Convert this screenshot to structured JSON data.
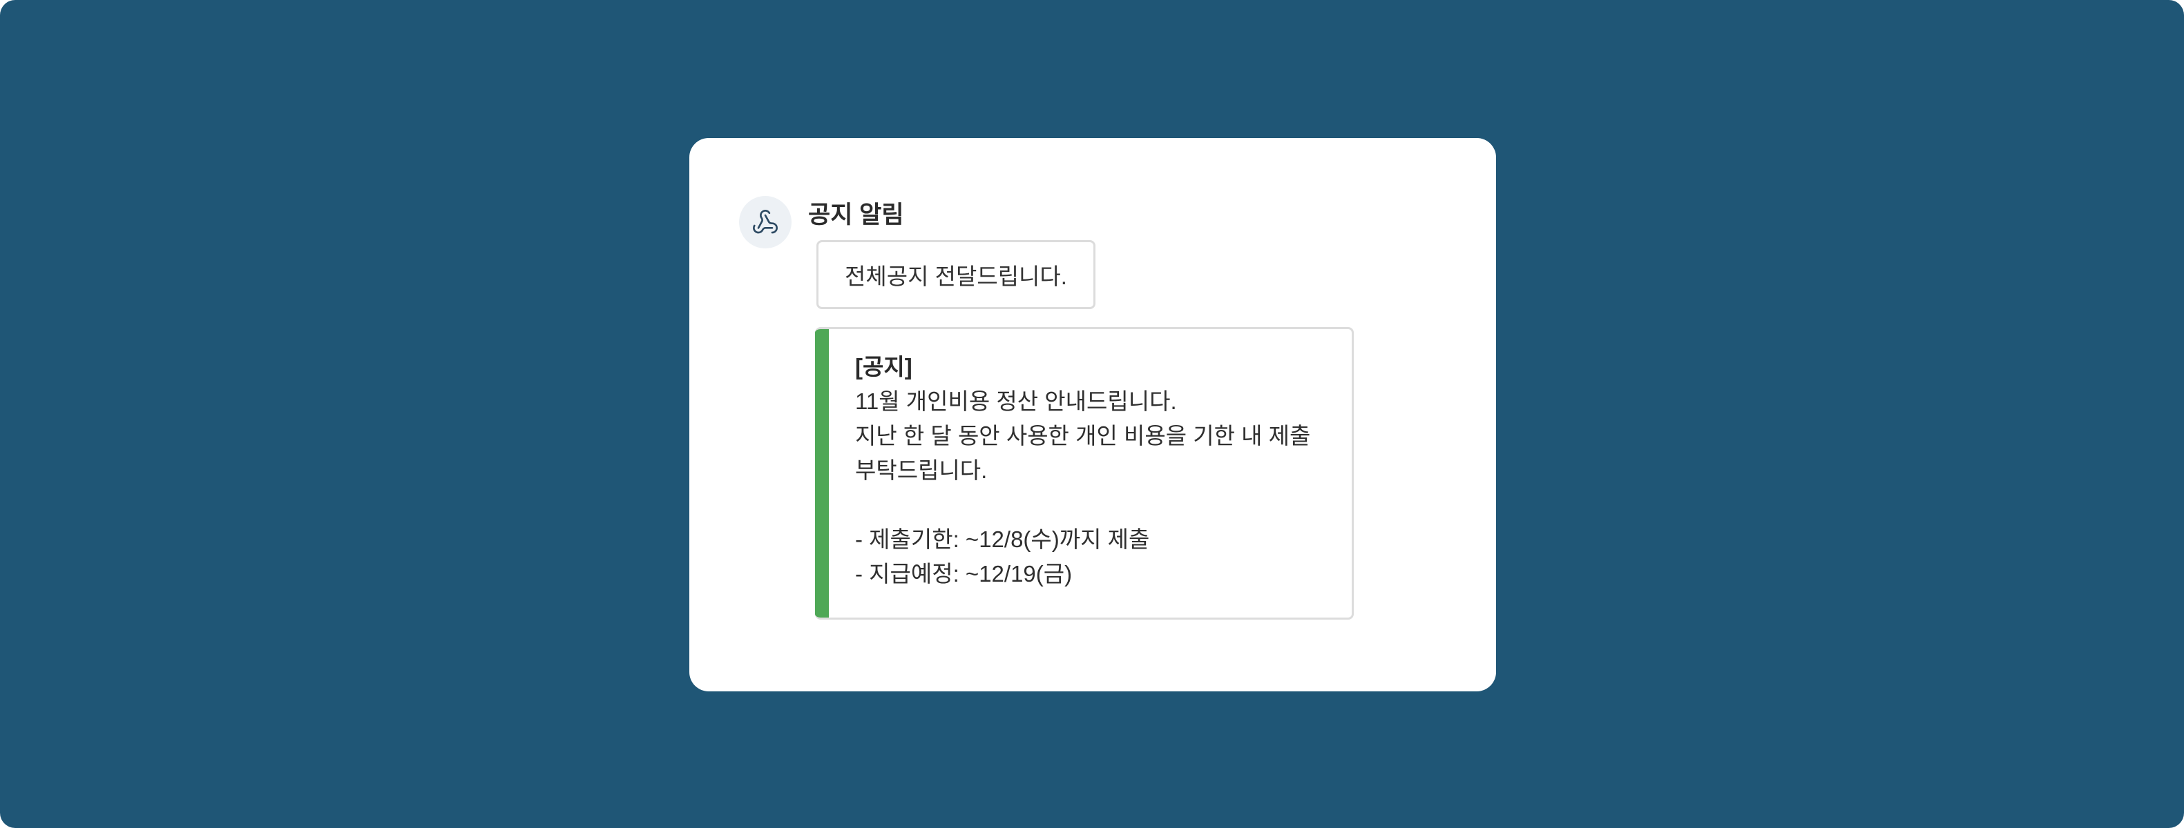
{
  "message": {
    "sender": "공지 알림",
    "avatar_icon": "webhook-icon",
    "text": "전체공지 전달드립니다.",
    "attachment": {
      "accent_color": "#4ea856",
      "title": "[공지]",
      "lines": [
        "11월 개인비용 정산 안내드립니다.",
        "지난 한 달 동안 사용한 개인 비용을 기한 내 제출",
        "부탁드립니다."
      ],
      "details": [
        "- 제출기한: ~12/8(수)까지 제출",
        "- 지급예정: ~12/19(금)"
      ]
    }
  },
  "colors": {
    "background": "#1f5676",
    "card": "#ffffff"
  }
}
